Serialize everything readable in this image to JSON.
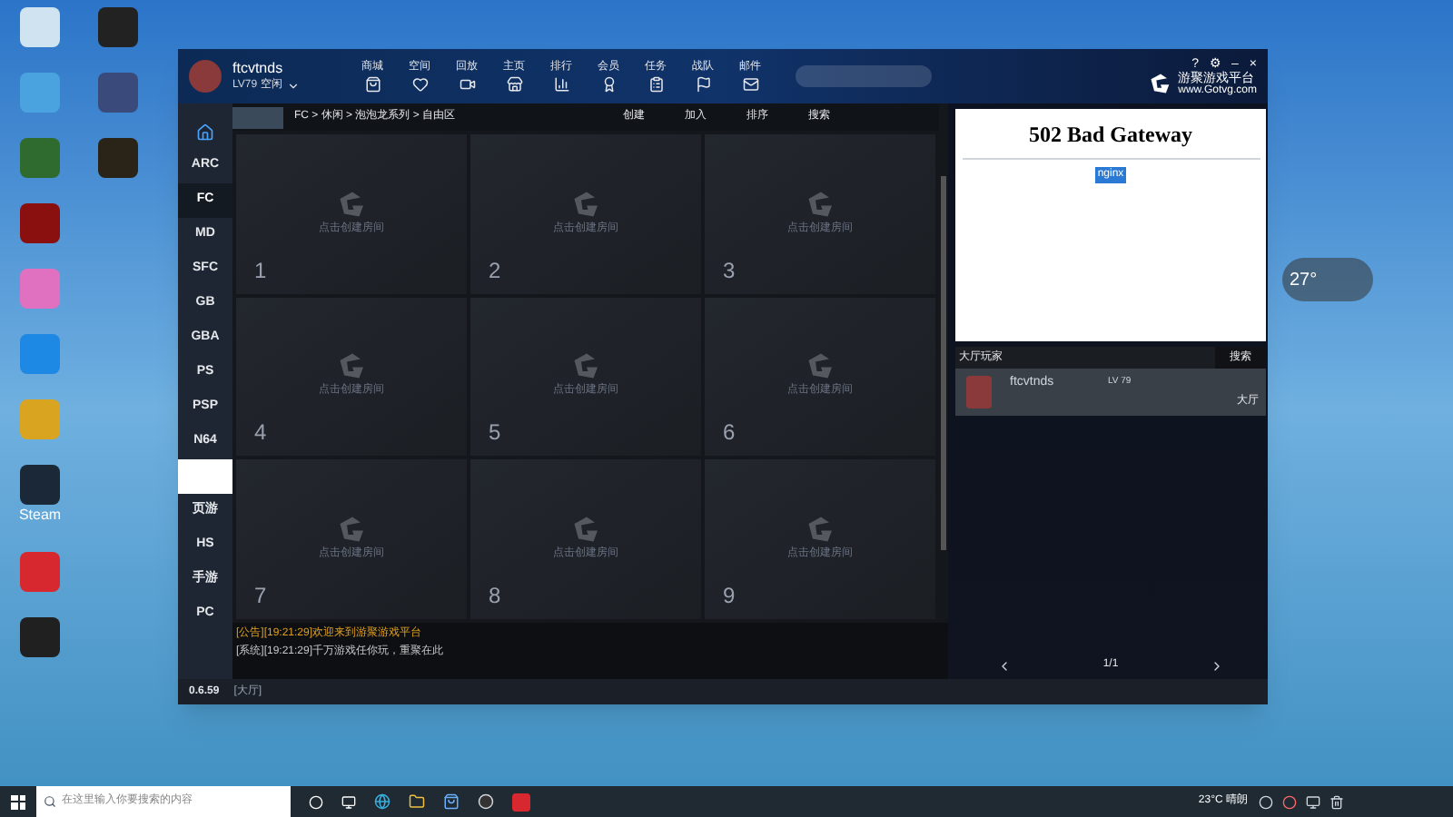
{
  "desktop_icons": [
    {
      "kind": "recycle"
    },
    {
      "kind": "penguin"
    },
    {
      "kind": "pc"
    },
    {
      "kind": "robot"
    },
    {
      "kind": "green"
    },
    {
      "kind": "dark"
    },
    {
      "kind": "red"
    },
    {
      "kind": "flower"
    },
    {
      "kind": "shield"
    },
    {
      "kind": "broom"
    },
    {
      "kind": "steam",
      "label": "Steam"
    },
    {
      "kind": "gotvg"
    },
    {
      "kind": "obs"
    }
  ],
  "app": {
    "user": {
      "name": "ftcvtnds",
      "level": "LV79",
      "status": "空闲"
    },
    "nav": [
      "商城",
      "空间",
      "回放",
      "主页",
      "排行",
      "会员",
      "任务",
      "战队",
      "邮件"
    ],
    "logo": {
      "title": "游聚游戏平台",
      "url": "www.Gotvg.com"
    },
    "window_buttons": [
      "?",
      "⚙",
      "–",
      "×"
    ],
    "breadcrumb": "FC > 休闲 > 泡泡龙系列 > 自由区",
    "actions": [
      "创建",
      "加入",
      "排序",
      "搜索"
    ],
    "sidebar": [
      {
        "kind": "home",
        "selected": false
      },
      {
        "label": "ARC",
        "kind": "text",
        "selected": false
      },
      {
        "label": "FC",
        "kind": "text",
        "selected": true
      },
      {
        "label": "MD",
        "kind": "text",
        "selected": false
      },
      {
        "label": "SFC",
        "kind": "text",
        "selected": false
      },
      {
        "label": "GB",
        "kind": "text",
        "selected": false
      },
      {
        "label": "GBA",
        "kind": "text",
        "selected": false
      },
      {
        "label": "PS",
        "kind": "text",
        "selected": false
      },
      {
        "label": "PSP",
        "kind": "text",
        "selected": false
      },
      {
        "label": "N64",
        "kind": "text",
        "selected": false
      },
      {
        "kind": "blank",
        "selected": false
      },
      {
        "label": "页游",
        "kind": "text",
        "selected": false
      },
      {
        "label": "HS",
        "kind": "text",
        "selected": false
      },
      {
        "label": "手游",
        "kind": "text",
        "selected": false
      },
      {
        "label": "PC",
        "kind": "text",
        "selected": false
      }
    ],
    "rooms": [
      {
        "number": "1",
        "hint": "点击创建房间"
      },
      {
        "number": "2",
        "hint": "点击创建房间"
      },
      {
        "number": "3",
        "hint": "点击创建房间"
      },
      {
        "number": "4",
        "hint": "点击创建房间"
      },
      {
        "number": "5",
        "hint": "点击创建房间"
      },
      {
        "number": "6",
        "hint": "点击创建房间"
      },
      {
        "number": "7",
        "hint": "点击创建房间"
      },
      {
        "number": "8",
        "hint": "点击创建房间"
      },
      {
        "number": "9",
        "hint": "点击创建房间"
      }
    ],
    "chat": [
      {
        "text": "[公告][19:21:29]欢迎来到游聚游戏平台",
        "color": "#e0a020"
      },
      {
        "text": "[系统][19:21:29]千万游戏任你玩，重聚在此",
        "color": "#c8c8c8"
      }
    ],
    "version": "0.6.59",
    "location": "[大厅]",
    "web_panel": {
      "title": "502 Bad Gateway",
      "server": "nginx"
    },
    "players": {
      "title": "大厅玩家",
      "search": "搜索",
      "list": [
        {
          "name": "ftcvtnds",
          "level": "LV 79",
          "place": "大厅"
        }
      ],
      "page": "1/1"
    }
  },
  "weather_widget": "27°",
  "taskbar": {
    "search_placeholder": "在这里输入你要搜索的内容",
    "weather": "23°C 晴朗"
  }
}
